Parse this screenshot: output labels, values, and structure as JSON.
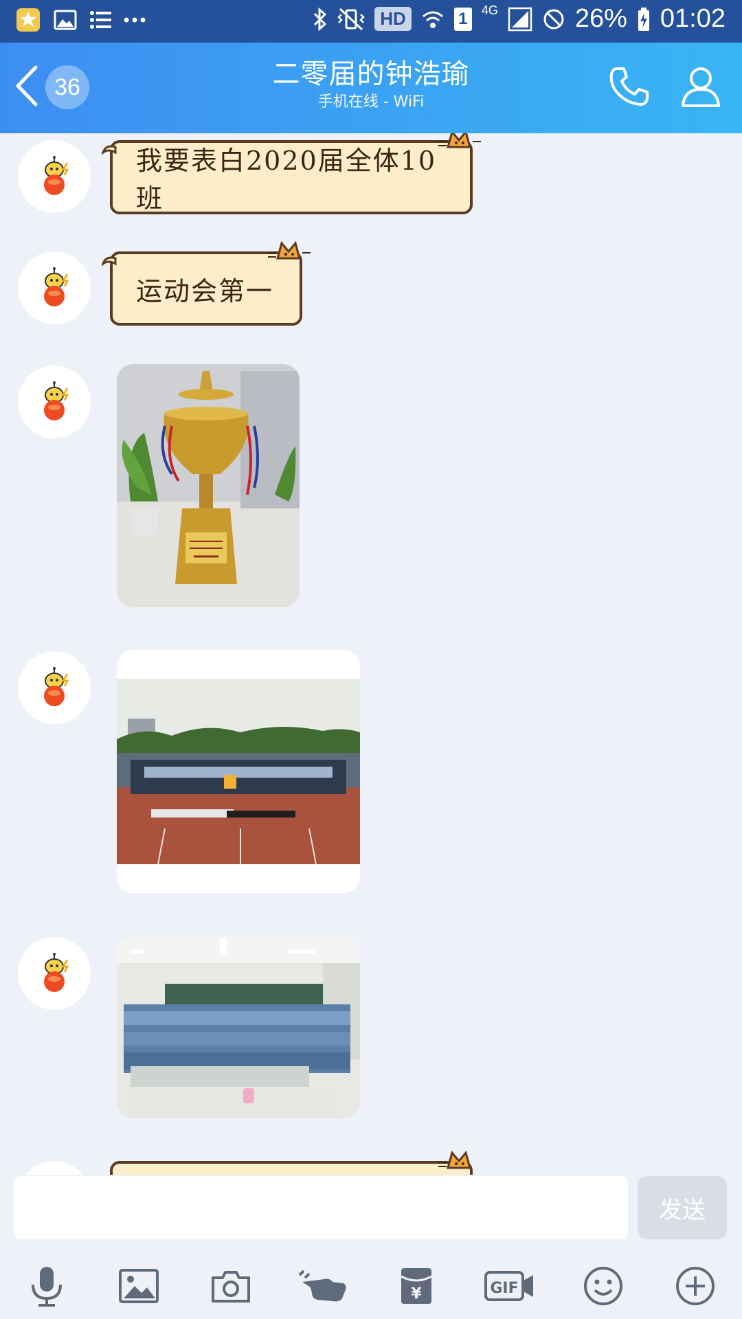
{
  "status_bar": {
    "hd": "HD",
    "sim": "1",
    "network": "4G",
    "battery": "26%",
    "time": "01:02"
  },
  "header": {
    "unread_count": "36",
    "title": "二零届的钟浩瑜",
    "subtitle": "手机在线 - WiFi"
  },
  "messages": [
    {
      "type": "text",
      "text": "我要表白2020届全体10班"
    },
    {
      "type": "text",
      "text": "运动会第一"
    },
    {
      "type": "image",
      "icon": "trophy-photo"
    },
    {
      "type": "image",
      "icon": "group-photo-track"
    },
    {
      "type": "image",
      "icon": "class-photo"
    }
  ],
  "input": {
    "placeholder": "",
    "send_label": "发送"
  },
  "toolbar": [
    "microphone-icon",
    "image-icon",
    "camera-icon",
    "poke-icon",
    "red-packet-icon",
    "gif-icon",
    "emoji-icon",
    "plus-icon"
  ],
  "colors": {
    "header_start": "#3d8ef2",
    "header_end": "#39b5f4",
    "status_bar": "#25509a",
    "bubble_fill": "#fbeec9",
    "bubble_border": "#5a3b23"
  }
}
